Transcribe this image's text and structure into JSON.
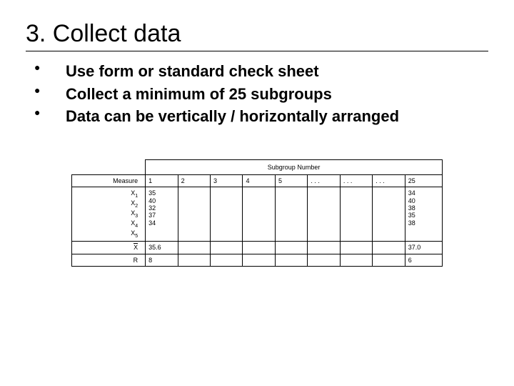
{
  "title": "3. Collect data",
  "bullets": [
    "Use form or standard check sheet",
    "Collect a minimum of 25 subgroups",
    "Data can be vertically / horizontally arranged"
  ],
  "table": {
    "subgroup_header": "Subgroup Number",
    "measure_label": "Measure",
    "col_headers": [
      "1",
      "2",
      "3",
      "4",
      "5",
      ". . .",
      ". . .",
      ". . .",
      "25"
    ],
    "obs_labels": [
      "X1",
      "X2",
      "X3",
      "X4",
      "X5"
    ],
    "col1_values": [
      "35",
      "40",
      "32",
      "37",
      "34"
    ],
    "col25_values": [
      "34",
      "40",
      "38",
      "35",
      "38"
    ],
    "mean_row": {
      "label": "X",
      "c1": "35.6",
      "c25": "37.0"
    },
    "range_row": {
      "label": "R",
      "c1": "8",
      "c25": "6"
    }
  }
}
